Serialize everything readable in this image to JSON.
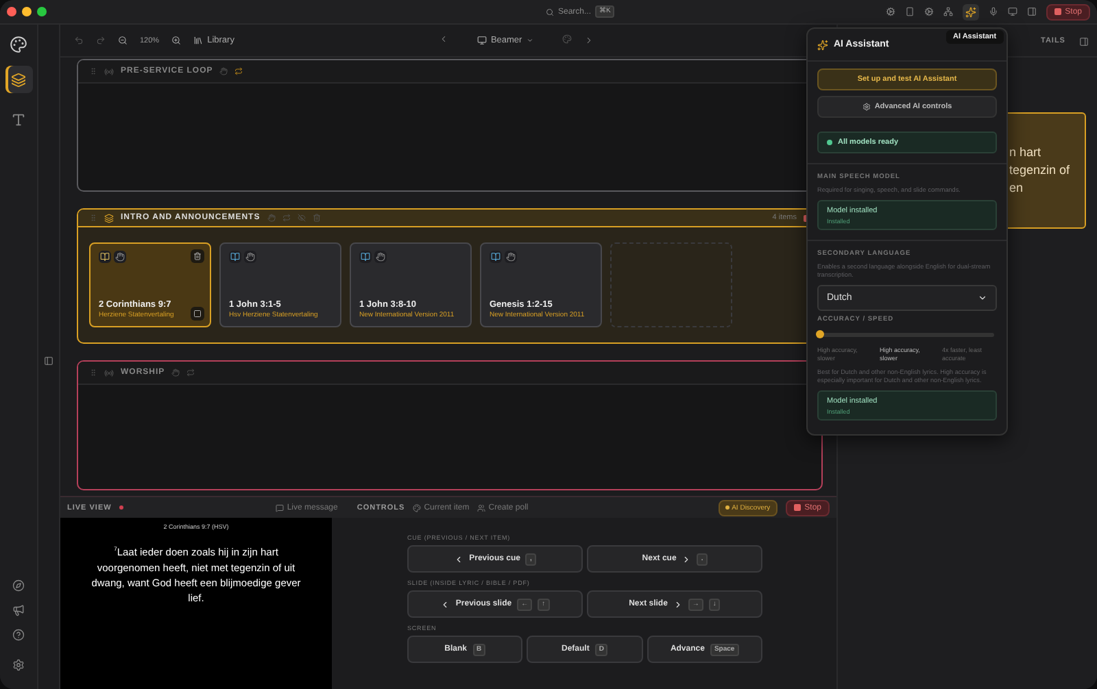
{
  "titlebar": {
    "search": {
      "placeholder": "Search...",
      "shortcut": "⌘K"
    },
    "stop": "Stop"
  },
  "rail": {
    "items": [
      {
        "kind": "layers",
        "selected": true
      },
      {
        "kind": "text",
        "selected": false
      }
    ]
  },
  "toolbar": {
    "zoom": "120%",
    "library": "Library",
    "display": "Beamer"
  },
  "sections": [
    {
      "kind": "empty",
      "title": "PRE-SERVICE LOOP",
      "color": "#5a5a5e",
      "selected": false
    },
    {
      "kind": "items",
      "title": "INTRO AND ANNOUNCEMENTS",
      "color": "#d9a024",
      "selected": true,
      "count": "4 items",
      "items": [
        {
          "title": "2 Corinthians 9:7",
          "subtitle": "Herziene Statenvertaling",
          "selected": true
        },
        {
          "title": "1 John 3:1-5",
          "subtitle": "Hsv Herziene Statenvertaling",
          "selected": false
        },
        {
          "title": "1 John 3:8-10",
          "subtitle": "New International Version 2011",
          "selected": false
        },
        {
          "title": "Genesis 1:2-15",
          "subtitle": "New International Version 2011",
          "selected": false
        }
      ]
    },
    {
      "kind": "empty",
      "title": "WORSHIP",
      "color": "#b5405a",
      "selected": false
    }
  ],
  "live": {
    "title": "LIVE VIEW",
    "live_message": "Live message",
    "reference": "2 Corinthians 9:7 (HSV)",
    "verse_number": "7",
    "text": "Laat ieder doen zoals hij in zijn hart voorgenomen heeft, niet met tegenzin of uit dwang, want God heeft een blijmoedige gever lief."
  },
  "controls": {
    "title": "CONTROLS",
    "actions": [
      "Current item",
      "Create poll"
    ],
    "ai_discovery": "AI Discovery",
    "stop": "Stop",
    "groups": [
      {
        "label": "CUE (PREVIOUS / NEXT ITEM)",
        "buttons": [
          {
            "kind": "prev",
            "label": "Previous cue",
            "keys": [
              ","
            ]
          },
          {
            "kind": "next",
            "label": "Next cue",
            "keys": [
              "."
            ]
          }
        ]
      },
      {
        "label": "SLIDE (INSIDE LYRIC / BIBLE / PDF)",
        "buttons": [
          {
            "kind": "prev",
            "label": "Previous slide",
            "keys": [
              "←",
              "↑"
            ]
          },
          {
            "kind": "next",
            "label": "Next slide",
            "keys": [
              "→",
              "↓"
            ]
          }
        ]
      },
      {
        "label": "SCREEN",
        "buttons": [
          {
            "kind": "plain",
            "label": "Blank",
            "keys": [
              "B"
            ]
          },
          {
            "kind": "plain",
            "label": "Default",
            "keys": [
              "D"
            ]
          },
          {
            "kind": "plain",
            "label": "Advance",
            "keys": [
              "Space"
            ]
          }
        ]
      }
    ]
  },
  "details": {
    "header": "TAILS",
    "card_lines": [
      "n hart",
      "tegenzin of",
      "en"
    ]
  },
  "assistant": {
    "tooltip": "AI Assistant",
    "title": "AI Assistant",
    "setup_button": "Set up and test AI Assistant",
    "advanced_button": "Advanced AI controls",
    "status": "All models ready",
    "main_model": {
      "heading": "MAIN SPEECH MODEL",
      "description": "Required for singing, speech, and slide commands.",
      "status_title": "Model installed",
      "status_detail": "Installed"
    },
    "secondary": {
      "heading": "SECONDARY LANGUAGE",
      "description": "Enables a second language alongside English for dual-stream transcription.",
      "language": "Dutch"
    },
    "accuracy": {
      "heading": "ACCURACY / SPEED",
      "level": 0,
      "options": [
        {
          "label": "High accuracy, slower",
          "selected": false
        },
        {
          "label": "High accuracy, slower",
          "selected": true
        },
        {
          "label": "4x faster, least accurate",
          "selected": false
        }
      ],
      "note": "Best for Dutch and other non-English lyrics. High accuracy is especially important for Dutch and other non-English lyrics.",
      "status_title": "Model installed",
      "status_detail": "Installed"
    }
  }
}
